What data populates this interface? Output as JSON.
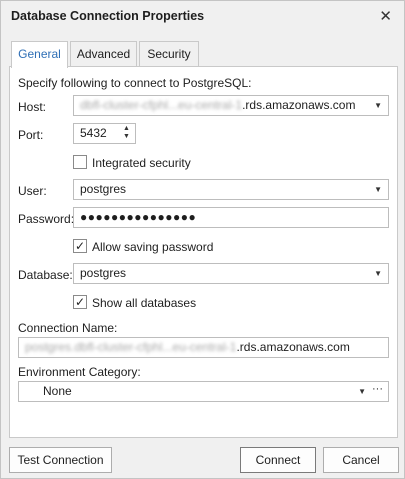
{
  "window": {
    "title": "Database Connection Properties"
  },
  "tabs": [
    {
      "label": "General"
    },
    {
      "label": "Advanced"
    },
    {
      "label": "Security"
    }
  ],
  "general": {
    "intro": "Specify following to connect to PostgreSQL:",
    "host": {
      "label": "Host:",
      "blurred_prefix": "dbfl-cluster-cfphl...eu-central-1",
      "value": ".rds.amazonaws.com"
    },
    "port": {
      "label": "Port:",
      "value": "5432"
    },
    "integrated_security": {
      "label": "Integrated security",
      "checked": false
    },
    "user": {
      "label": "User:",
      "value": "postgres"
    },
    "password": {
      "label": "Password:",
      "value": "●●●●●●●●●●●●●●●"
    },
    "allow_saving": {
      "label": "Allow saving password",
      "checked": true
    },
    "database": {
      "label": "Database:",
      "value": "postgres"
    },
    "show_all": {
      "label": "Show all databases",
      "checked": true
    },
    "connection_name": {
      "label": "Connection Name:",
      "blurred_prefix": "postgres.dbfl-cluster-cfphl...eu-central-1",
      "value": ".rds.amazonaws.com"
    },
    "environment": {
      "label": "Environment Category:",
      "value": "None"
    }
  },
  "buttons": {
    "test": "Test Connection",
    "connect": "Connect",
    "cancel": "Cancel"
  }
}
